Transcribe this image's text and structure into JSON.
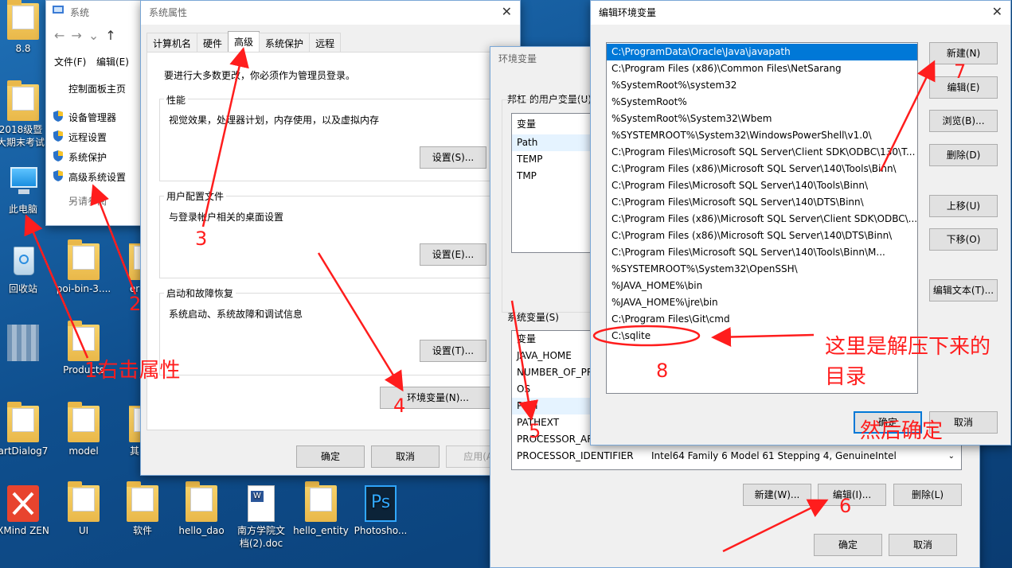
{
  "desktop": {
    "icons": [
      {
        "label": "8.8"
      },
      {
        "label": "2018级暨大期末考试"
      },
      {
        "label": "此电脑"
      },
      {
        "label": "回收站"
      },
      {
        "label": "poi-bin-3...."
      },
      {
        "label": "er"
      },
      {
        "label": "Products"
      },
      {
        "label": "artDialog7"
      },
      {
        "label": "model"
      },
      {
        "label": "其"
      },
      {
        "label": "XMind ZEN"
      },
      {
        "label": "UI"
      },
      {
        "label": "软件"
      },
      {
        "label": "hello_dao"
      },
      {
        "label": "南方学院文档(2).doc"
      },
      {
        "label": "hello_entity"
      },
      {
        "label": "Photosho..."
      }
    ]
  },
  "system_window": {
    "title": "系统",
    "menu": [
      "文件(F)",
      "编辑(E)"
    ],
    "links": [
      "控制面板主页",
      "设备管理器",
      "远程设置",
      "系统保护",
      "高级系统设置"
    ],
    "see_also": "另请参阅"
  },
  "sysprops": {
    "title": "系统属性",
    "tabs": [
      "计算机名",
      "硬件",
      "高级",
      "系统保护",
      "远程"
    ],
    "admin_note": "要进行大多数更改，你必须作为管理员登录。",
    "performance": {
      "legend": "性能",
      "desc": "视觉效果，处理器计划，内存使用，以及虚拟内存",
      "button": "设置(S)..."
    },
    "profile": {
      "legend": "用户配置文件",
      "desc": "与登录帐户相关的桌面设置",
      "button": "设置(E)..."
    },
    "startup": {
      "legend": "启动和故障恢复",
      "desc": "系统启动、系统故障和调试信息",
      "button": "设置(T)..."
    },
    "env_button": "环境变量(N)...",
    "ok": "确定",
    "cancel": "取消",
    "apply": "应用(A)"
  },
  "envvars": {
    "title": "环境变量",
    "user_legend": "邦杠 的用户变量(U)",
    "user_header": "变量",
    "user_vars": [
      "Path",
      "TEMP",
      "TMP"
    ],
    "sys_legend": "系统变量(S)",
    "sys_header": "变量",
    "sys_vars": [
      "JAVA_HOME",
      "NUMBER_OF_PR",
      "OS",
      "Path",
      "PATHEXT",
      "PROCESSOR_AR",
      "PROCESSOR_IDENTIFIER"
    ],
    "proc_id_value": "Intel64 Family 6 Model 61 Stepping 4, GenuineIntel",
    "new": "新建(W)...",
    "edit": "编辑(I)...",
    "delete": "删除(L)",
    "ok": "确定",
    "cancel": "取消"
  },
  "editenv": {
    "title": "编辑环境变量",
    "paths": [
      "C:\\ProgramData\\Oracle\\Java\\javapath",
      "C:\\Program Files (x86)\\Common Files\\NetSarang",
      "%SystemRoot%\\system32",
      "%SystemRoot%",
      "%SystemRoot%\\System32\\Wbem",
      "%SYSTEMROOT%\\System32\\WindowsPowerShell\\v1.0\\",
      "C:\\Program Files\\Microsoft SQL Server\\Client SDK\\ODBC\\130\\T...",
      "C:\\Program Files (x86)\\Microsoft SQL Server\\140\\Tools\\Binn\\",
      "C:\\Program Files\\Microsoft SQL Server\\140\\Tools\\Binn\\",
      "C:\\Program Files\\Microsoft SQL Server\\140\\DTS\\Binn\\",
      "C:\\Program Files (x86)\\Microsoft SQL Server\\Client SDK\\ODBC\\...",
      "C:\\Program Files (x86)\\Microsoft SQL Server\\140\\DTS\\Binn\\",
      "C:\\Program Files\\Microsoft SQL Server\\140\\Tools\\Binn\\M...",
      "%SYSTEMROOT%\\System32\\OpenSSH\\",
      "%JAVA_HOME%\\bin",
      "%JAVA_HOME%\\jre\\bin",
      "C:\\Program Files\\Git\\cmd",
      "C:\\sqlite"
    ],
    "buttons": {
      "new": "新建(N)",
      "edit": "编辑(E)",
      "browse": "浏览(B)...",
      "delete": "删除(D)",
      "up": "上移(U)",
      "down": "下移(O)",
      "edit_text": "编辑文本(T)..."
    },
    "ok": "确定",
    "cancel": "取消"
  },
  "annotations": {
    "step1": "1右击属性",
    "n2": "2",
    "n3": "3",
    "n4": "4",
    "n5": "5",
    "n6": "6",
    "n7": "7",
    "n8": "8",
    "note_line1": "这里是解压下来的",
    "note_line2": "目录",
    "confirm": "然后确定"
  },
  "colors": {
    "annotation": "#ff1d1d",
    "selection": "#0078d7",
    "desktop": "#1f6fb5"
  }
}
